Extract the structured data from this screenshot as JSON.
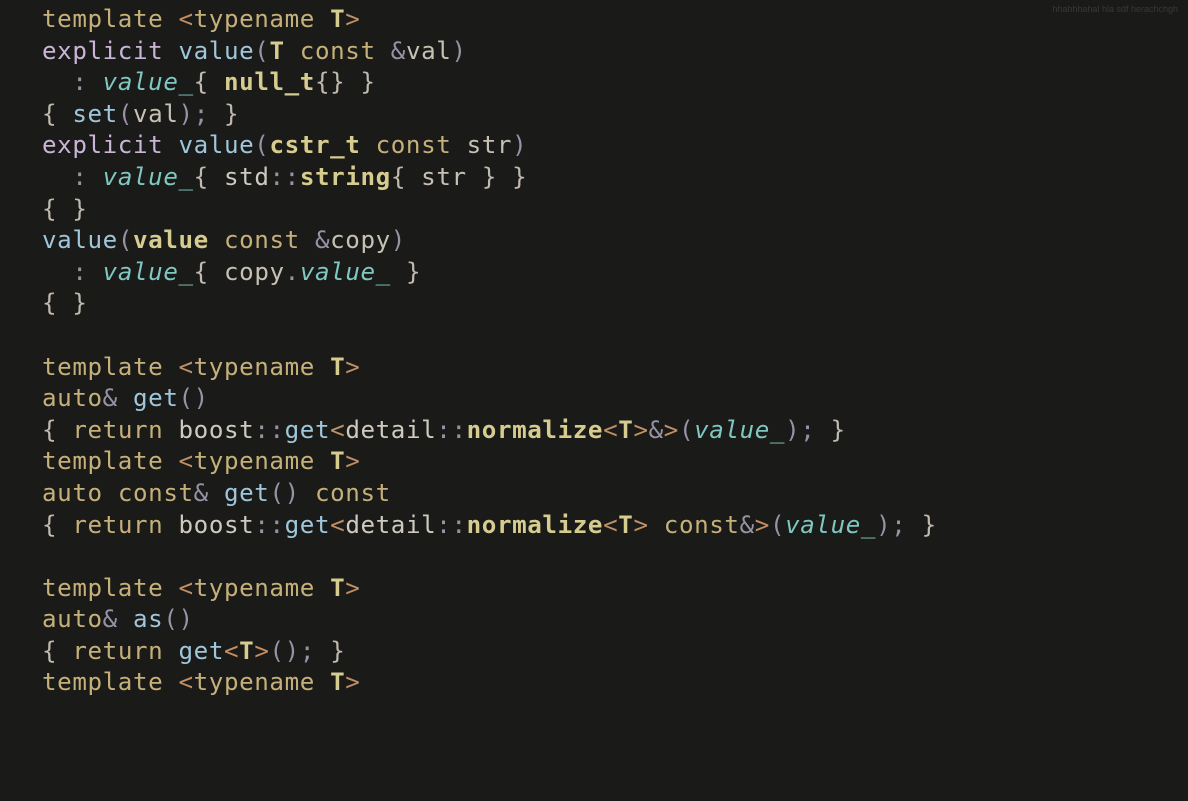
{
  "watermark": "hhahhhahal hla sdf herachchgh",
  "code": {
    "lines": [
      [
        [
          "kw",
          "template"
        ],
        [
          "",
          ""
        ],
        [
          "ang",
          " <"
        ],
        [
          "kw",
          "typename"
        ],
        [
          "",
          " "
        ],
        [
          "ty",
          "T"
        ],
        [
          "ang",
          ">"
        ]
      ],
      [
        [
          "kw2",
          "explicit"
        ],
        [
          "",
          " "
        ],
        [
          "fn",
          "value"
        ],
        [
          "op",
          "("
        ],
        [
          "ty",
          "T"
        ],
        [
          "",
          " "
        ],
        [
          "kw",
          "const"
        ],
        [
          "",
          " "
        ],
        [
          "op",
          "&"
        ],
        [
          "var",
          "val"
        ],
        [
          "op",
          ")"
        ]
      ],
      [
        [
          "",
          "  "
        ],
        [
          "op",
          ":"
        ],
        [
          "",
          " "
        ],
        [
          "mem",
          "value_"
        ],
        [
          "brc",
          "{"
        ],
        [
          "",
          " "
        ],
        [
          "fnb",
          "null_t"
        ],
        [
          "brc",
          "{}"
        ],
        [
          "",
          " "
        ],
        [
          "brc",
          "}"
        ]
      ],
      [
        [
          "brc",
          "{"
        ],
        [
          "",
          " "
        ],
        [
          "fn",
          "set"
        ],
        [
          "op",
          "("
        ],
        [
          "var",
          "val"
        ],
        [
          "op",
          ")"
        ],
        [
          "op",
          ";"
        ],
        [
          "",
          " "
        ],
        [
          "brc",
          "}"
        ]
      ],
      [
        [
          "kw2",
          "explicit"
        ],
        [
          "",
          " "
        ],
        [
          "fn",
          "value"
        ],
        [
          "op",
          "("
        ],
        [
          "ty",
          "cstr_t"
        ],
        [
          "",
          " "
        ],
        [
          "kw",
          "const"
        ],
        [
          "",
          " "
        ],
        [
          "var",
          "str"
        ],
        [
          "op",
          ")"
        ]
      ],
      [
        [
          "",
          "  "
        ],
        [
          "op",
          ":"
        ],
        [
          "",
          " "
        ],
        [
          "mem",
          "value_"
        ],
        [
          "brc",
          "{"
        ],
        [
          "",
          " "
        ],
        [
          "ns",
          "std"
        ],
        [
          "op",
          "::"
        ],
        [
          "ty",
          "string"
        ],
        [
          "brc",
          "{"
        ],
        [
          "",
          " "
        ],
        [
          "var",
          "str"
        ],
        [
          "",
          " "
        ],
        [
          "brc",
          "}"
        ],
        [
          "",
          " "
        ],
        [
          "brc",
          "}"
        ]
      ],
      [
        [
          "brc",
          "{"
        ],
        [
          "",
          " "
        ],
        [
          "brc",
          "}"
        ]
      ],
      [
        [
          "fn",
          "value"
        ],
        [
          "op",
          "("
        ],
        [
          "ty",
          "value"
        ],
        [
          "",
          " "
        ],
        [
          "kw",
          "const"
        ],
        [
          "",
          " "
        ],
        [
          "op",
          "&"
        ],
        [
          "var",
          "copy"
        ],
        [
          "op",
          ")"
        ]
      ],
      [
        [
          "",
          "  "
        ],
        [
          "op",
          ":"
        ],
        [
          "",
          " "
        ],
        [
          "mem",
          "value_"
        ],
        [
          "brc",
          "{"
        ],
        [
          "",
          " "
        ],
        [
          "var",
          "copy"
        ],
        [
          "op",
          "."
        ],
        [
          "mem",
          "value_"
        ],
        [
          "",
          " "
        ],
        [
          "brc",
          "}"
        ]
      ],
      [
        [
          "brc",
          "{"
        ],
        [
          "",
          " "
        ],
        [
          "brc",
          "}"
        ]
      ],
      [
        [
          "",
          ""
        ]
      ],
      [
        [
          "kw",
          "template"
        ],
        [
          "",
          ""
        ],
        [
          "ang",
          " <"
        ],
        [
          "kw",
          "typename"
        ],
        [
          "",
          " "
        ],
        [
          "ty",
          "T"
        ],
        [
          "ang",
          ">"
        ]
      ],
      [
        [
          "kw",
          "auto"
        ],
        [
          "op",
          "&"
        ],
        [
          "",
          " "
        ],
        [
          "fn",
          "get"
        ],
        [
          "op",
          "()"
        ]
      ],
      [
        [
          "brc",
          "{"
        ],
        [
          "",
          " "
        ],
        [
          "kw",
          "return"
        ],
        [
          "",
          " "
        ],
        [
          "ns",
          "boost"
        ],
        [
          "op",
          "::"
        ],
        [
          "fn",
          "get"
        ],
        [
          "ang",
          "<"
        ],
        [
          "ns",
          "detail"
        ],
        [
          "op",
          "::"
        ],
        [
          "det",
          "normalize"
        ],
        [
          "ang",
          "<"
        ],
        [
          "ty",
          "T"
        ],
        [
          "ang",
          ">"
        ],
        [
          "op",
          "&"
        ],
        [
          "ang",
          ">"
        ],
        [
          "op",
          "("
        ],
        [
          "mem",
          "value_"
        ],
        [
          "op",
          ")"
        ],
        [
          "op",
          ";"
        ],
        [
          "",
          " "
        ],
        [
          "brc",
          "}"
        ]
      ],
      [
        [
          "kw",
          "template"
        ],
        [
          "",
          ""
        ],
        [
          "ang",
          " <"
        ],
        [
          "kw",
          "typename"
        ],
        [
          "",
          " "
        ],
        [
          "ty",
          "T"
        ],
        [
          "ang",
          ">"
        ]
      ],
      [
        [
          "kw",
          "auto"
        ],
        [
          "",
          " "
        ],
        [
          "kw",
          "const"
        ],
        [
          "op",
          "&"
        ],
        [
          "",
          " "
        ],
        [
          "fn",
          "get"
        ],
        [
          "op",
          "()"
        ],
        [
          "",
          " "
        ],
        [
          "kw",
          "const"
        ]
      ],
      [
        [
          "brc",
          "{"
        ],
        [
          "",
          " "
        ],
        [
          "kw",
          "return"
        ],
        [
          "",
          " "
        ],
        [
          "ns",
          "boost"
        ],
        [
          "op",
          "::"
        ],
        [
          "fn",
          "get"
        ],
        [
          "ang",
          "<"
        ],
        [
          "ns",
          "detail"
        ],
        [
          "op",
          "::"
        ],
        [
          "det",
          "normalize"
        ],
        [
          "ang",
          "<"
        ],
        [
          "ty",
          "T"
        ],
        [
          "ang",
          ">"
        ],
        [
          "",
          " "
        ],
        [
          "kw",
          "const"
        ],
        [
          "op",
          "&"
        ],
        [
          "ang",
          ">"
        ],
        [
          "op",
          "("
        ],
        [
          "mem",
          "value_"
        ],
        [
          "op",
          ")"
        ],
        [
          "op",
          ";"
        ],
        [
          "",
          " "
        ],
        [
          "brc",
          "}"
        ]
      ],
      [
        [
          "",
          ""
        ]
      ],
      [
        [
          "kw",
          "template"
        ],
        [
          "",
          ""
        ],
        [
          "ang",
          " <"
        ],
        [
          "kw",
          "typename"
        ],
        [
          "",
          " "
        ],
        [
          "ty",
          "T"
        ],
        [
          "ang",
          ">"
        ]
      ],
      [
        [
          "kw",
          "auto"
        ],
        [
          "op",
          "&"
        ],
        [
          "",
          " "
        ],
        [
          "fn",
          "as"
        ],
        [
          "op",
          "()"
        ]
      ],
      [
        [
          "brc",
          "{"
        ],
        [
          "",
          " "
        ],
        [
          "kw",
          "return"
        ],
        [
          "",
          " "
        ],
        [
          "fn",
          "get"
        ],
        [
          "ang",
          "<"
        ],
        [
          "ty",
          "T"
        ],
        [
          "ang",
          ">"
        ],
        [
          "op",
          "()"
        ],
        [
          "op",
          ";"
        ],
        [
          "",
          " "
        ],
        [
          "brc",
          "}"
        ]
      ],
      [
        [
          "kw",
          "template"
        ],
        [
          "",
          ""
        ],
        [
          "ang",
          " <"
        ],
        [
          "kw",
          "typename"
        ],
        [
          "",
          " "
        ],
        [
          "ty",
          "T"
        ],
        [
          "ang",
          ">"
        ]
      ]
    ]
  }
}
